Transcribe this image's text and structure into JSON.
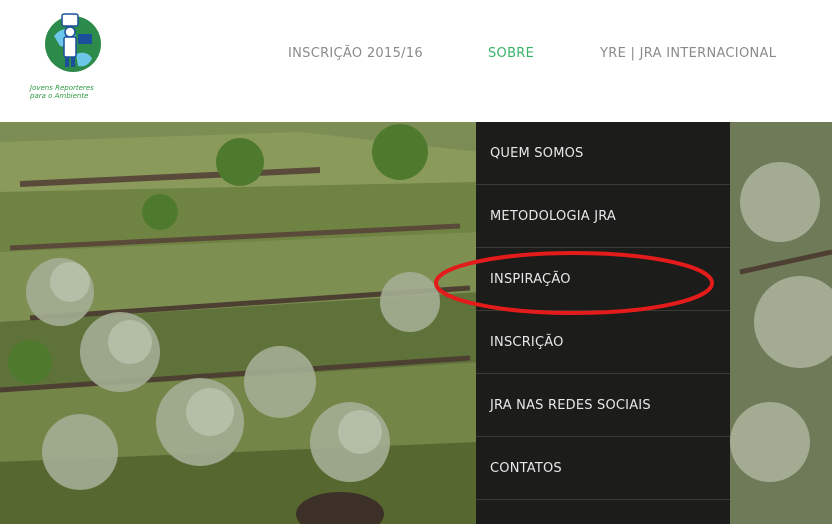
{
  "logo": {
    "line1": "Jovens Reporteres",
    "line2": "para o Ambiente"
  },
  "nav": {
    "items": [
      {
        "label": "INSCRIÇÃO 2015/16",
        "active": false
      },
      {
        "label": "SOBRE",
        "active": true
      },
      {
        "label": "YRE | JRA INTERNACIONAL",
        "active": false
      }
    ]
  },
  "dropdown": {
    "items": [
      {
        "label": "QUEM SOMOS"
      },
      {
        "label": "METODOLOGIA JRA"
      },
      {
        "label": "INSPIRAÇÃO"
      },
      {
        "label": "INSCRIÇÃO"
      },
      {
        "label": "JRA NAS REDES SOCIAIS"
      },
      {
        "label": "CONTATOS"
      }
    ]
  },
  "annotation": {
    "color": "#e31b1b",
    "target": "INSPIRAÇÃO"
  },
  "colors": {
    "nav_text": "#8a8a8a",
    "nav_active": "#39b26a",
    "dropdown_bg": "#1c1c1b",
    "dropdown_text": "#e8e8e8"
  }
}
